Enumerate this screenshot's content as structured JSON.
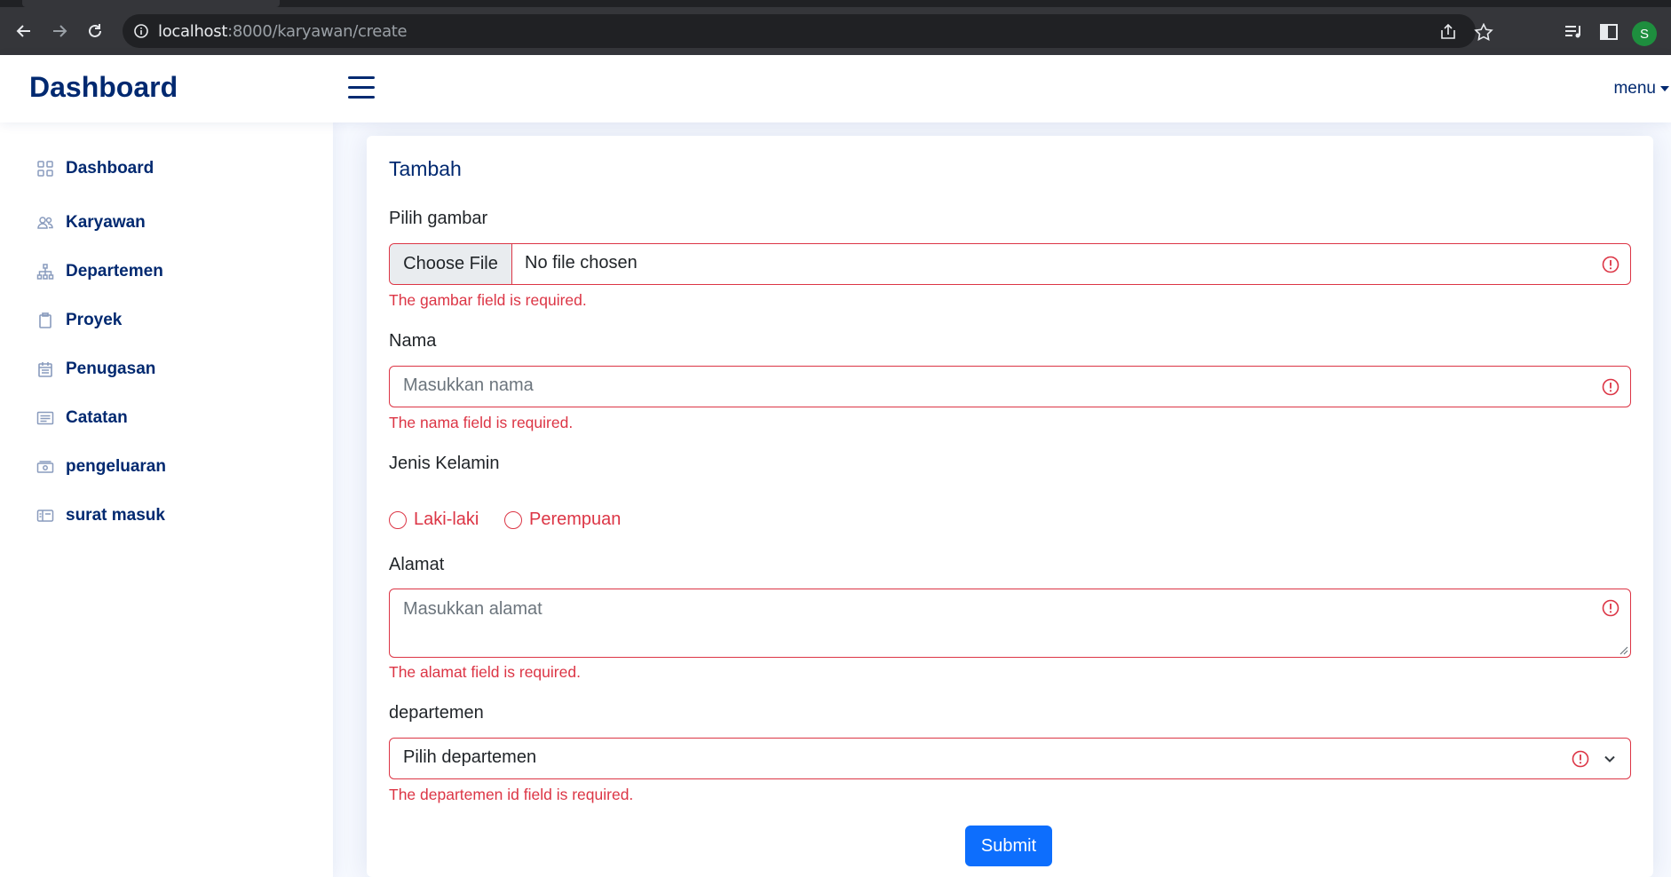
{
  "browser": {
    "url_host": "localhost",
    "url_path": ":8000/karyawan/create",
    "profile_initial": "S",
    "icons": [
      "back-icon",
      "forward-icon",
      "reload-icon",
      "info-icon",
      "share-icon",
      "star-icon",
      "media-icon",
      "sidepanel-icon"
    ]
  },
  "header": {
    "brand": "Dashboard",
    "menu_label": "menu"
  },
  "sidebar": {
    "items": [
      {
        "label": "Dashboard",
        "icon": "grid-icon"
      },
      {
        "label": "Karyawan",
        "icon": "people-icon"
      },
      {
        "label": "Departemen",
        "icon": "diagram-icon"
      },
      {
        "label": "Proyek",
        "icon": "clipboard-icon"
      },
      {
        "label": "Penugasan",
        "icon": "calendar-icon"
      },
      {
        "label": "Catatan",
        "icon": "card-text-icon"
      },
      {
        "label": "pengeluaran",
        "icon": "cash-icon"
      },
      {
        "label": "surat masuk",
        "icon": "mail-card-icon"
      }
    ]
  },
  "form": {
    "title": "Tambah",
    "gambar": {
      "label": "Pilih gambar",
      "button": "Choose File",
      "status": "No file chosen",
      "error": "The gambar field is required."
    },
    "nama": {
      "label": "Nama",
      "placeholder": "Masukkan nama",
      "error": "The nama field is required."
    },
    "jenis_kelamin": {
      "label": "Jenis Kelamin",
      "options": [
        "Laki-laki",
        "Perempuan"
      ]
    },
    "alamat": {
      "label": "Alamat",
      "placeholder": "Masukkan alamat",
      "error": "The alamat field is required."
    },
    "departemen": {
      "label": "departemen",
      "selected": "Pilih departemen",
      "error": "The departemen id field is required."
    },
    "submit_label": "Submit"
  },
  "colors": {
    "brand": "#012970",
    "danger": "#dc3545",
    "primary": "#0d6efd"
  }
}
